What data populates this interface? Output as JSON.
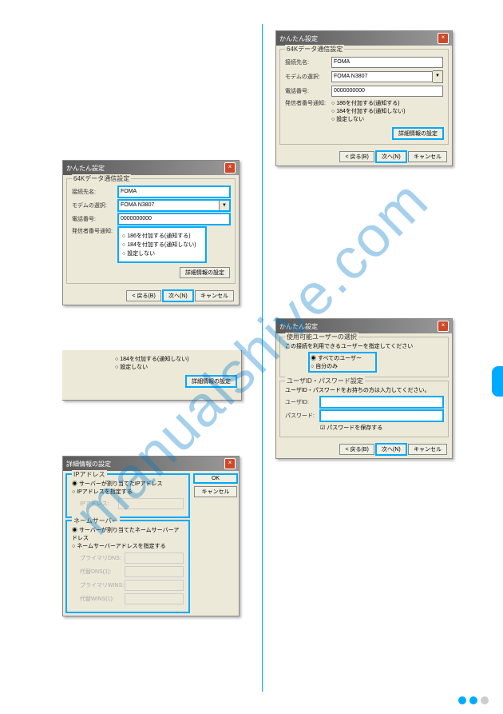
{
  "watermark": "manualshive.com",
  "dialogs": {
    "d1": {
      "title": "かんたん設定",
      "group": "64Kデータ通信設定",
      "rows": {
        "r1_label": "接続先名:",
        "r1_value": "FOMA",
        "r2_label": "モデムの選択:",
        "r2_value": "FOMA N3807",
        "r3_label": "電話番号:",
        "r3_value": "0000000000",
        "r4_label": "発信者番号通知:",
        "radio1": "186を付加する(通知する)",
        "radio2": "184を付加する(通知しない)",
        "radio3": "設定しない"
      },
      "detail_btn": "詳細情報の設定",
      "back": "< 戻る(B)",
      "next": "次へ(N)",
      "cancel": "キャンセル"
    },
    "d2": {
      "title": "かんたん設定",
      "group": "64Kデータ通信設定",
      "rows": {
        "r1_label": "接続先名:",
        "r1_value": "FOMA",
        "r2_label": "モデムの選択:",
        "r2_value": "FOMA N3807",
        "r3_label": "電話番号:",
        "r3_value": "0000000000",
        "r4_label": "発信者番号通知:",
        "radio1": "186を付加する(通知する)",
        "radio2": "184を付加する(通知しない)",
        "radio3": "設定しない"
      },
      "detail_btn": "詳細情報の設定",
      "back": "< 戻る(B)",
      "next": "次へ(N)",
      "cancel": "キャンセル"
    },
    "strip": {
      "radio2": "184を付加する(通知しない)",
      "radio3": "設定しない",
      "detail_btn": "詳細情報の設定"
    },
    "d3": {
      "title": "詳細情報の設定",
      "g1_label": "IPアドレス",
      "g1_radio1": "サーバーが割り当てたIPアドレス",
      "g1_radio2": "IPアドレスを指定する",
      "g1_ip": "IPアドレス:",
      "g2_label": "ネームサーバー",
      "g2_radio1": "サーバーが割り当てたネームサーバーアドレス",
      "g2_radio2": "ネームサーバーアドレスを指定する",
      "dns1": "プライマリDNS:",
      "dns2": "代替DNS(1):",
      "dns3": "プライマリWINS:",
      "dns4": "代替WINS(1):",
      "ok": "OK",
      "cancel": "キャンセル"
    },
    "d4": {
      "title": "かんたん設定",
      "g1_label": "使用可能ユーザーの選択",
      "g1_text": "この接続を利用できるユーザーを指定してください",
      "g1_radio1": "すべてのユーザー",
      "g1_radio2": "自分のみ",
      "g2_label": "ユーザID・パスワード設定",
      "g2_text": "ユーザID・パスワードをお持ちの方は入力してください。",
      "uid_label": "ユーザID:",
      "pwd_label": "パスワード:",
      "save_pwd": "パスワードを保存する",
      "back": "< 戻る(B)",
      "next": "次へ(N)",
      "cancel": "キャンセル"
    }
  }
}
